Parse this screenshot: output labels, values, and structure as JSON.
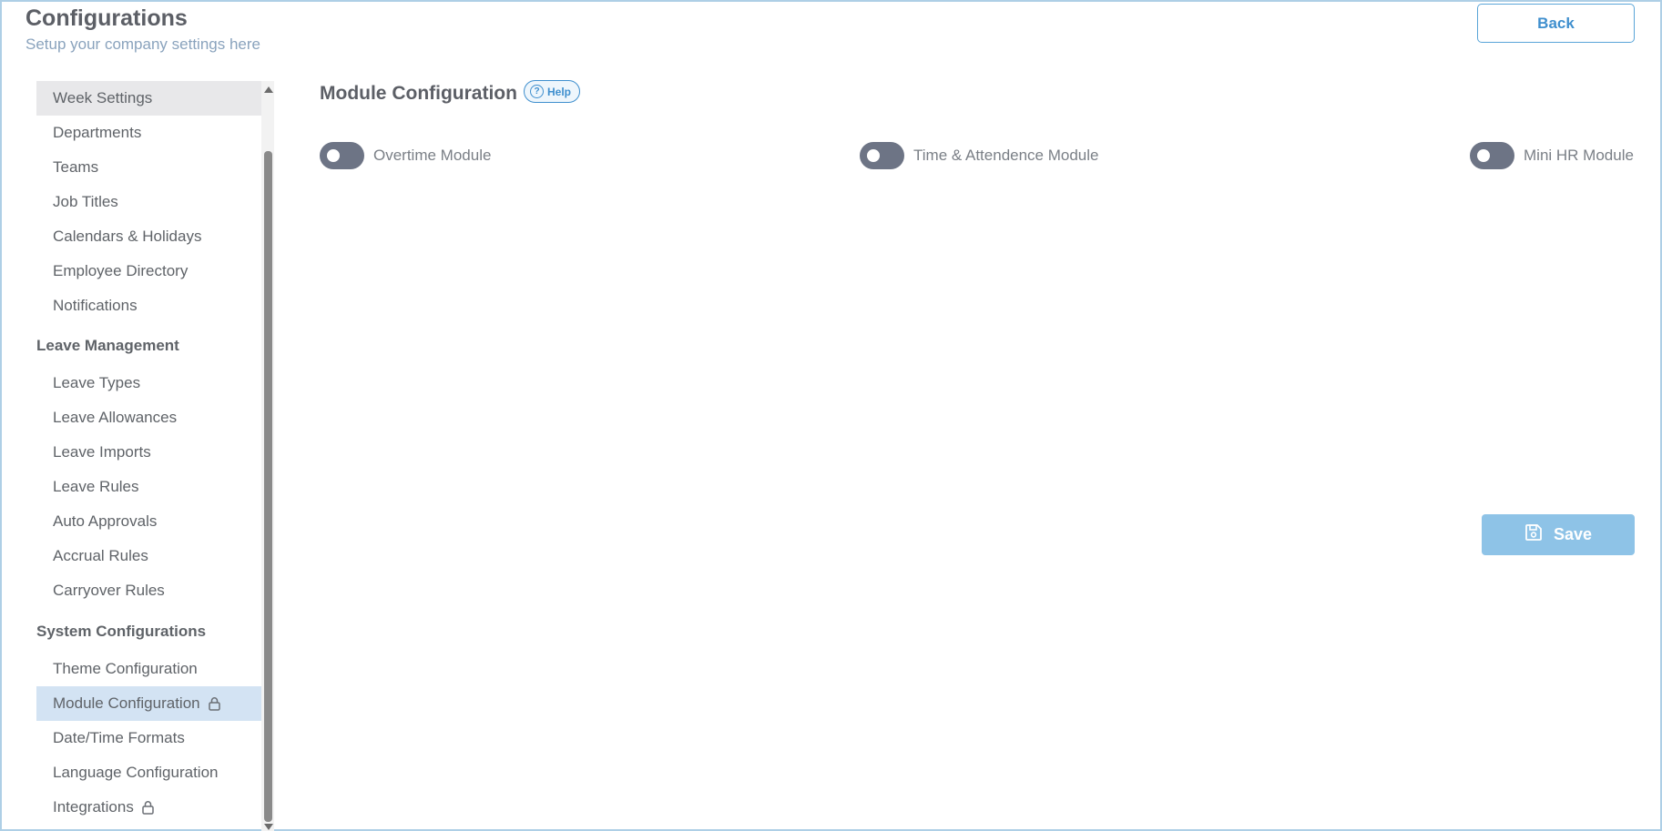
{
  "header": {
    "title": "Configurations",
    "subtitle": "Setup your company settings here",
    "back_label": "Back"
  },
  "sidebar": {
    "items_top": [
      {
        "label": "Week Settings",
        "state": "hover"
      },
      {
        "label": "Departments"
      },
      {
        "label": "Teams"
      },
      {
        "label": "Job Titles"
      },
      {
        "label": "Calendars & Holidays"
      },
      {
        "label": "Employee Directory"
      },
      {
        "label": "Notifications"
      }
    ],
    "section_leave": "Leave Management",
    "items_leave": [
      {
        "label": "Leave Types"
      },
      {
        "label": "Leave Allowances"
      },
      {
        "label": "Leave Imports"
      },
      {
        "label": "Leave Rules"
      },
      {
        "label": "Auto Approvals"
      },
      {
        "label": "Accrual Rules"
      },
      {
        "label": "Carryover Rules"
      }
    ],
    "section_system": "System Configurations",
    "items_system": [
      {
        "label": "Theme Configuration"
      },
      {
        "label": "Module Configuration",
        "state": "active",
        "icon": "lock-icon"
      },
      {
        "label": "Date/Time Formats"
      },
      {
        "label": "Language Configuration"
      },
      {
        "label": "Integrations",
        "icon": "lock-icon"
      }
    ]
  },
  "main": {
    "title": "Module Configuration",
    "help_label": "Help",
    "modules": [
      {
        "label": "Overtime Module",
        "enabled": false
      },
      {
        "label": "Time & Attendence Module",
        "enabled": false
      },
      {
        "label": "Mini HR Module",
        "enabled": false
      }
    ],
    "save_label": "Save"
  },
  "colors": {
    "accent": "#3f8fce",
    "active_item_bg": "#d3e3f3",
    "hover_item_bg": "#e8e8ea",
    "toggle_off": "#6d7485",
    "save_disabled": "#8ec3e7"
  }
}
